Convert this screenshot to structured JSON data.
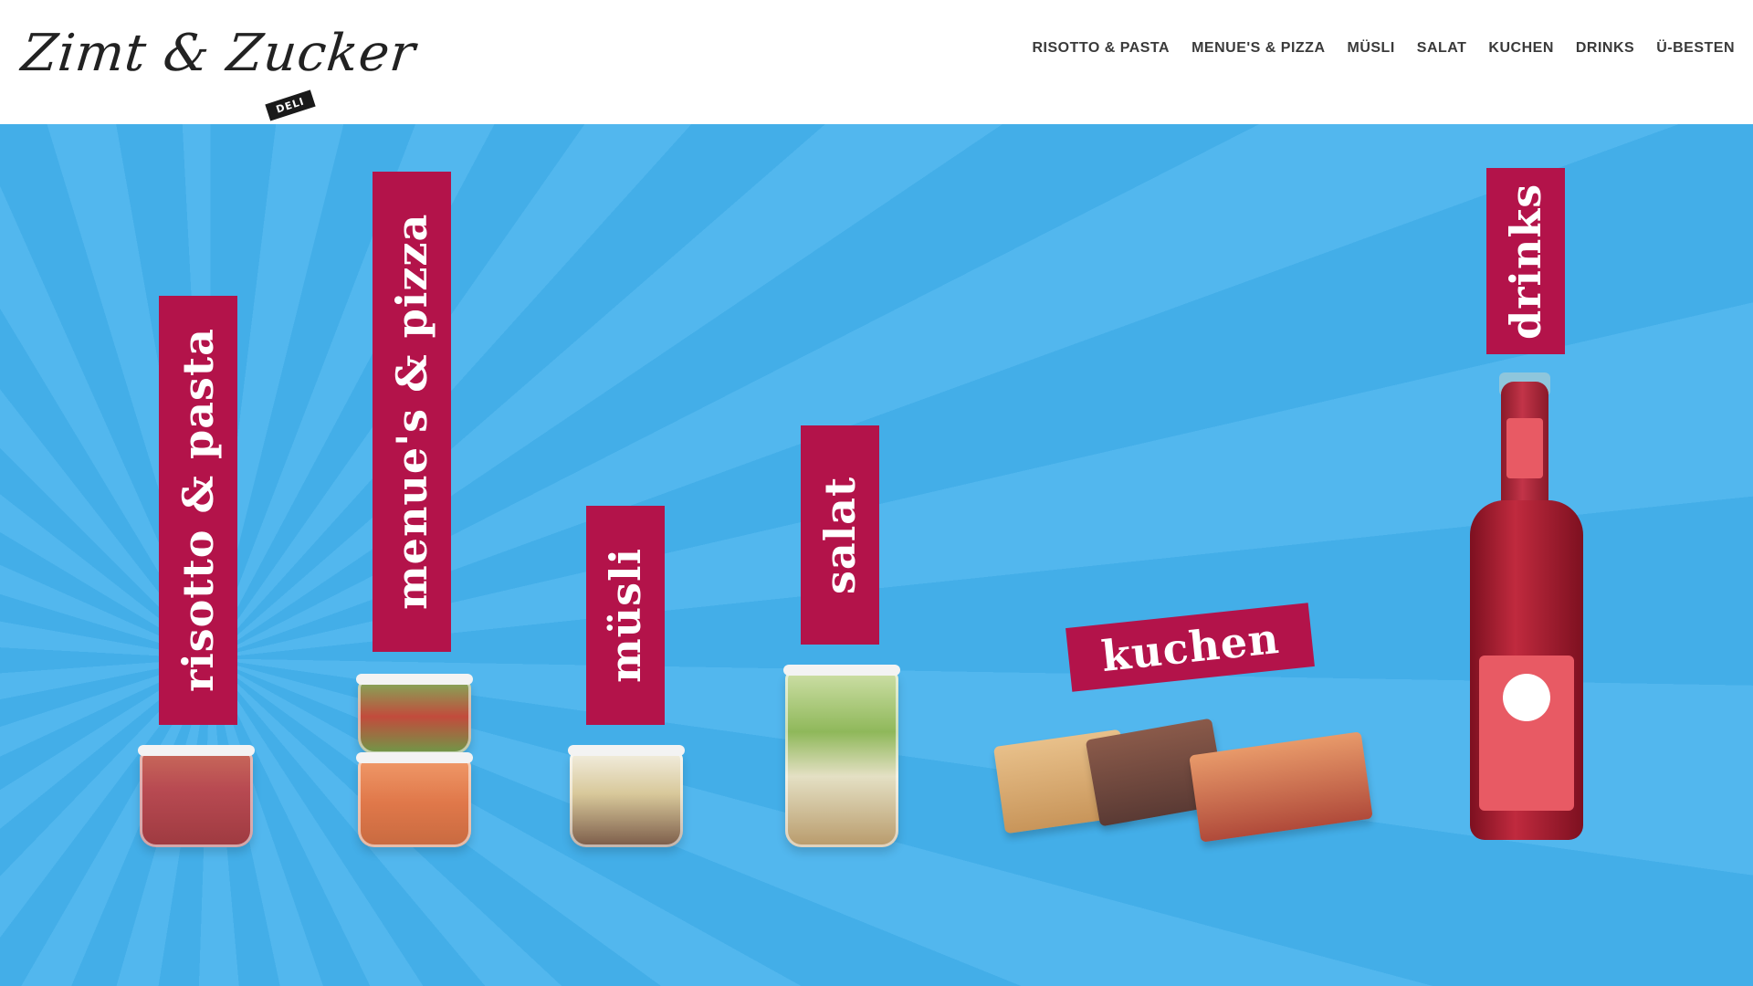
{
  "header": {
    "logo": {
      "script": "Zimt & Zucker",
      "tag": "DELI"
    },
    "nav": [
      "RISOTTO & PASTA",
      "MENUE'S & PIZZA",
      "MÜSLI",
      "SALAT",
      "KUCHEN",
      "DRINKS",
      "Ü-BESTEN"
    ]
  },
  "categories": {
    "risotto": "risotto & pasta",
    "menues": "menue's & pizza",
    "muesli": "müsli",
    "salat": "salat",
    "kuchen": "kuchen",
    "drinks": "drinks"
  },
  "colors": {
    "label_bg": "#b3134a",
    "hero_blue": "#43aee8",
    "hero_blue_light": "#52b7ee"
  },
  "icons": {
    "risotto_product": "risotto-jar-icon",
    "menues_product": "stacked-jars-icon",
    "muesli_product": "muesli-jar-icon",
    "salat_product": "salad-jar-icon",
    "kuchen_product": "cake-slices-icon",
    "drinks_product": "bottle-icon"
  }
}
